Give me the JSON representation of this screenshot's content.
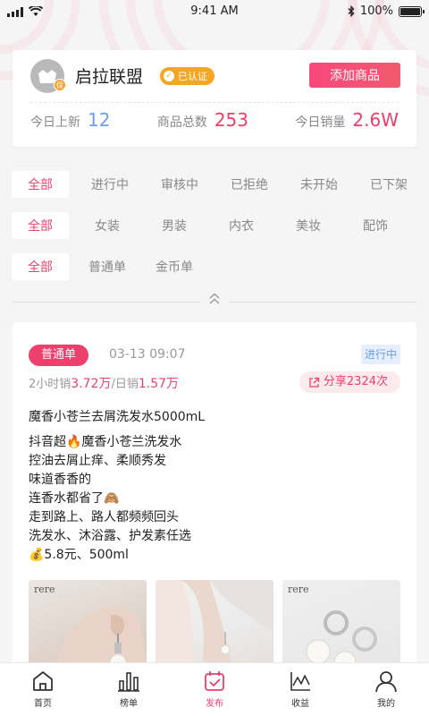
{
  "status_bar": {
    "time": "9:41 AM",
    "battery": "100%",
    "battery_level": 1.0
  },
  "shop": {
    "name": "启拉联盟",
    "avatar_badge": "保",
    "verified_label": "已认证",
    "add_button_label": "添加商品",
    "stats": [
      {
        "label": "今日上新",
        "value": "12"
      },
      {
        "label": "商品总数",
        "value": "253"
      },
      {
        "label": "今日销量",
        "value": "2.6W"
      }
    ]
  },
  "filters": {
    "status": [
      "全部",
      "进行中",
      "审核中",
      "已拒绝",
      "未开始",
      "已下架"
    ],
    "category": [
      "全部",
      "女装",
      "男装",
      "内衣",
      "美妆",
      "配饰"
    ],
    "type": [
      "全部",
      "普通单",
      "金币单"
    ]
  },
  "product": {
    "type_tag": "普通单",
    "time": "03-13 09:07",
    "status_tag": "进行中",
    "sales_2h_label": "2小时销",
    "sales_2h_value": "3.72万",
    "sales_day_label": "/日销",
    "sales_day_value": "1.57万",
    "share_label": "分享2324次",
    "title": "魔香小苍兰去屑洗发水5000mL",
    "description": [
      "抖音超🔥魔香小苍兰洗发水",
      "控油去屑止痒、柔顺秀发",
      "味道香香的",
      "连香水都省了🙈",
      "走到路上、路人都频频回头",
      "洗发水、沐浴露、护发素任选",
      "💰5.8元、500ml"
    ],
    "thumbnails": [
      {
        "brand": "rere",
        "icon": "earring-photo"
      },
      {
        "brand": "",
        "icon": "model-earring-photo"
      },
      {
        "brand": "rere",
        "icon": "pearl-earrings-photo"
      }
    ]
  },
  "tab_bar": [
    {
      "label": "首页",
      "icon": "home-icon"
    },
    {
      "label": "榜单",
      "icon": "ranking-icon"
    },
    {
      "label": "发布",
      "icon": "publish-icon"
    },
    {
      "label": "收益",
      "icon": "earnings-icon"
    },
    {
      "label": "我的",
      "icon": "profile-icon"
    }
  ],
  "colors": {
    "accent": "#ef3f6d",
    "blue": "#6a9fe8",
    "verified": "#f5a623"
  }
}
